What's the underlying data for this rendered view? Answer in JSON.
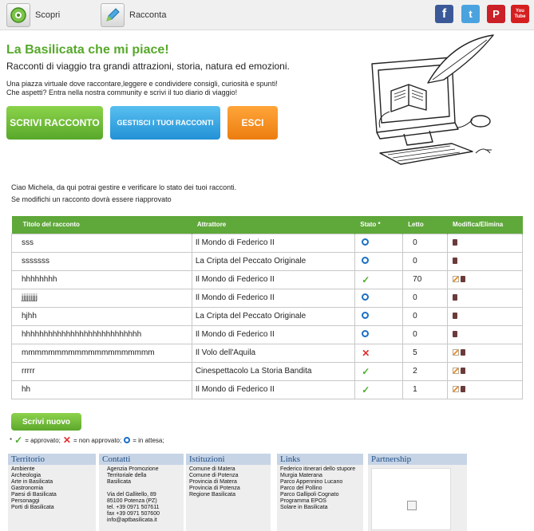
{
  "nav": {
    "scopri_label": "Scopri",
    "racconta_label": "Racconta"
  },
  "social": [
    {
      "icon": "facebook-icon",
      "glyph": "f",
      "color": "#3b5998"
    },
    {
      "icon": "twitter-icon",
      "glyph": "t",
      "color": "#4aa3df"
    },
    {
      "icon": "pinterest-icon",
      "glyph": "P",
      "color": "#cb2027"
    },
    {
      "icon": "youtube-icon",
      "glyph": "You Tube",
      "color": "#d61f1f"
    }
  ],
  "header": {
    "title": "La Basilicata che mi piace!",
    "subtitle": "Racconti di viaggio tra grandi attrazioni, storia, natura ed emozioni.",
    "desc_line1": "Una piazza virtuale dove raccontare,leggere e condividere consigli, curiosità e spunti!",
    "desc_line2": "Che aspetti? Entra nella nostra community e scrivi il tuo diario di viaggio!"
  },
  "buttons": {
    "scrivi": "SCRIVI RACCONTO",
    "gestisci": "GESTISCI I TUOI RACCONTI",
    "esci": "ESCI"
  },
  "greeting": {
    "line1": "Ciao Michela, da qui potrai gestire e verificare lo stato dei tuoi racconti.",
    "line2": "Se modifichi un racconto dovrà essere riapprovato"
  },
  "table": {
    "headers": {
      "titolo": "Titolo del racconto",
      "attrattore": "Attrattore",
      "stato": "Stato *",
      "letto": "Letto",
      "modifica": "Modifica/Elimina"
    },
    "rows": [
      {
        "titolo": "sss",
        "attrattore": "Il Mondo di Federico II",
        "stato": "attesa",
        "letto": "0",
        "edit": false
      },
      {
        "titolo": "sssssss",
        "attrattore": "La Cripta del Peccato Originale",
        "stato": "attesa",
        "letto": "0",
        "edit": false
      },
      {
        "titolo": "hhhhhhhh",
        "attrattore": "Il Mondo di Federico II",
        "stato": "approvato",
        "letto": "70",
        "edit": true
      },
      {
        "titolo": "jjjjjjjjj",
        "attrattore": "Il Mondo di Federico II",
        "stato": "attesa",
        "letto": "0",
        "edit": false
      },
      {
        "titolo": "hjhh",
        "attrattore": "La Cripta del Peccato Originale",
        "stato": "attesa",
        "letto": "0",
        "edit": false
      },
      {
        "titolo": "hhhhhhhhhhhhhhhhhhhhhhhhhhh",
        "attrattore": "Il Mondo di Federico II",
        "stato": "attesa",
        "letto": "0",
        "edit": false
      },
      {
        "titolo": "mmmmmmmmmmmmmmmmmmmm",
        "attrattore": "Il Volo dell'Aquila",
        "stato": "non_approvato",
        "letto": "5",
        "edit": true
      },
      {
        "titolo": "rrrrr",
        "attrattore": "Cinespettacolo La Storia Bandita",
        "stato": "approvato",
        "letto": "2",
        "edit": true
      },
      {
        "titolo": "hh",
        "attrattore": "Il Mondo di Federico II",
        "stato": "approvato",
        "letto": "1",
        "edit": true
      }
    ]
  },
  "scrivi_nuovo": "Scrivi nuovo",
  "legend": {
    "star": "*",
    "approvato": "= approvato;",
    "non_approvato": "= non approvato;",
    "attesa": "= in attesa;"
  },
  "footer": {
    "territorio": {
      "title": "Territorio",
      "items": [
        "Ambiente",
        "Archeologia",
        "Arte in Basilicata",
        "Gastronomia",
        "Paesi di Basilicata",
        "Personaggi",
        "Porti di Basilicata"
      ]
    },
    "contatti": {
      "title": "Contatti",
      "items": [
        "Agenzia Promozione",
        "Territoriale della",
        "Basilicata",
        "",
        "Via del Gallitello, 89",
        "85100 Potenza (PZ)",
        "tel. +39 0971 507611",
        "fax +39 0971 507600",
        "info@aptbasilicata.it"
      ]
    },
    "istituzioni": {
      "title": "Istituzioni",
      "items": [
        "Comune di Matera",
        "Comune di Potenza",
        "Provincia di Matera",
        "Provincia di Potenza",
        "Regione Basilicata"
      ]
    },
    "links": {
      "title": "Links",
      "items": [
        "Federico itinerari dello stupore",
        "Murgia Materana",
        "Parco Appennino Lucano",
        "Parco del Pollino",
        "Parco Gallipoli Cognato",
        "Programma EPOS",
        "Solare in Basilicata"
      ]
    },
    "partnership": {
      "title": "Partnership"
    }
  },
  "colors": {
    "green": "#57a82b",
    "blue": "#2a9fe0",
    "orange": "#f28c1c",
    "table_header": "#5fa83a"
  }
}
